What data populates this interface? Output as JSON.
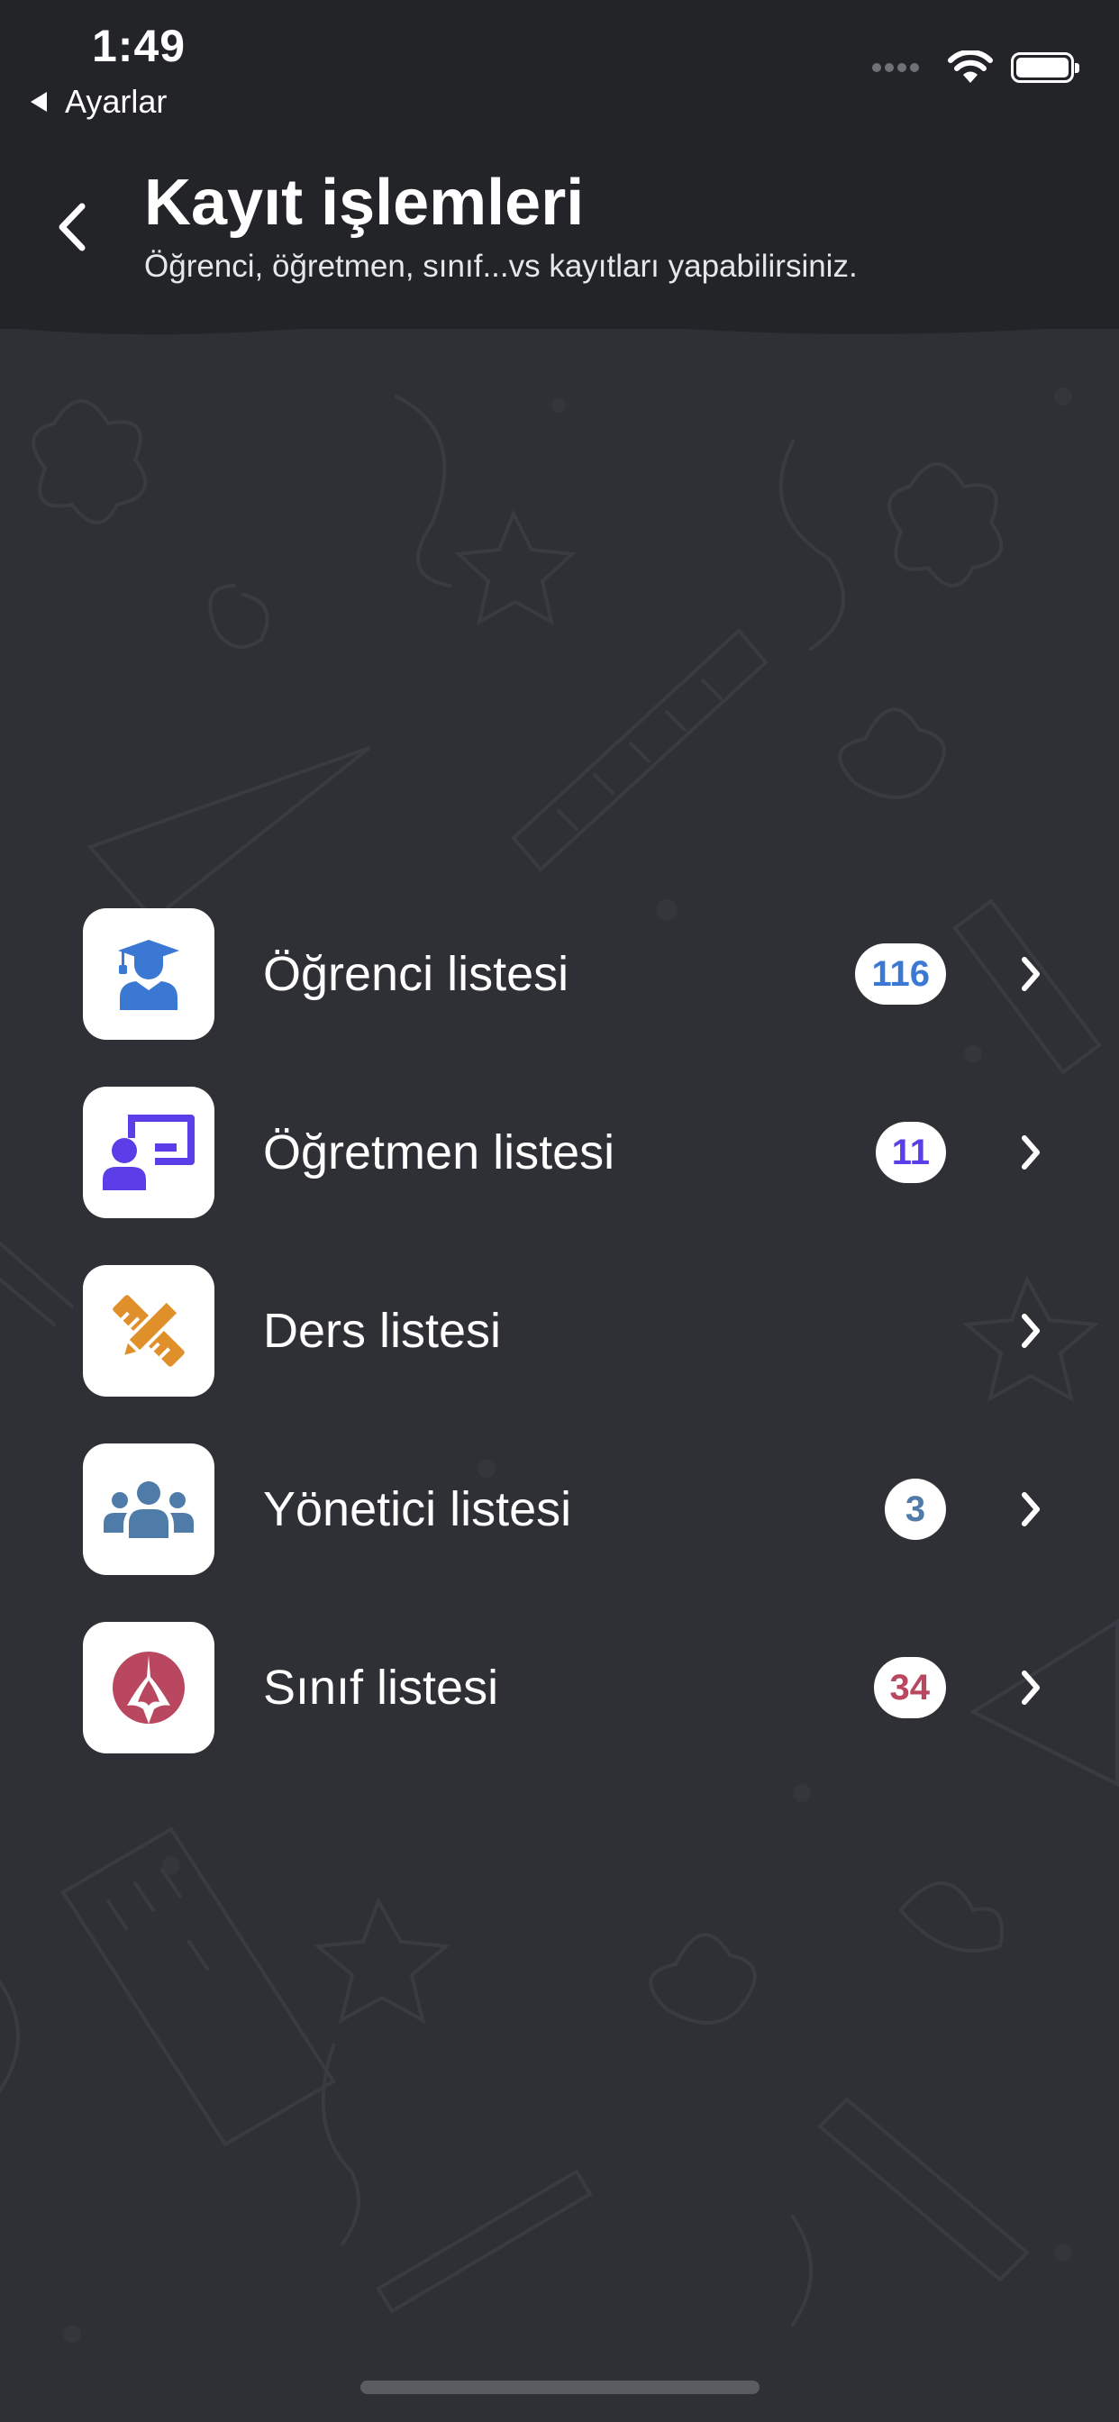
{
  "status_bar": {
    "time": "1:49",
    "back_app": "Ayarlar"
  },
  "header": {
    "title": "Kayıt işlemleri",
    "subtitle": "Öğrenci, öğretmen, sınıf...vs kayıtları yapabilirsiniz."
  },
  "icons": {
    "nav_back": "chevron-left-icon",
    "student": "graduate-icon",
    "teacher": "teacher-board-icon",
    "course": "pencil-ruler-icon",
    "admin": "users-group-icon",
    "class": "school-logo-icon",
    "row_chevron": "chevron-right-icon"
  },
  "colors": {
    "background": "#2e3036",
    "header": "#232428",
    "student": "#3a78d4",
    "teacher": "#5b3ee8",
    "course": "#e0902a",
    "admin": "#4f7ba8",
    "class": "#b8475f"
  },
  "list": {
    "items": [
      {
        "label": "Öğrenci listesi",
        "count": "116"
      },
      {
        "label": "Öğretmen listesi",
        "count": "11"
      },
      {
        "label": "Ders listesi",
        "count": ""
      },
      {
        "label": "Yönetici listesi",
        "count": "3"
      },
      {
        "label": "Sınıf listesi",
        "count": "34"
      }
    ]
  }
}
